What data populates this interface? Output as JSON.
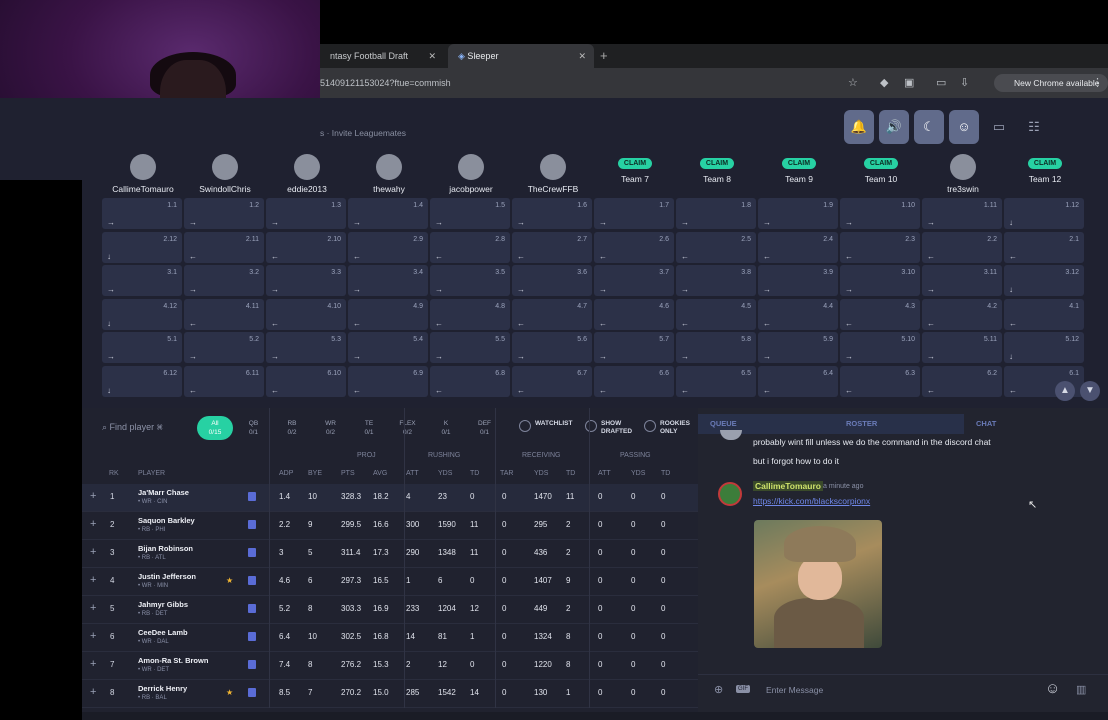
{
  "browser": {
    "tab1": "ntasy Football Draft Cheat",
    "tab2": "Sleeper",
    "url": "51409121153024?ftue=commish",
    "update": "New Chrome available"
  },
  "header": {
    "invite": "s · Invite Leaguemates"
  },
  "teams": [
    {
      "name": "CallimeTomauro",
      "online": true,
      "claim": false
    },
    {
      "name": "SwindollChris",
      "online": true,
      "claim": false
    },
    {
      "name": "eddie2013",
      "online": true,
      "claim": false
    },
    {
      "name": "thewahy",
      "online": false,
      "claim": false
    },
    {
      "name": "jacobpower",
      "online": true,
      "claim": false
    },
    {
      "name": "TheCrewFFB",
      "online": true,
      "claim": false
    },
    {
      "name": "Team 7",
      "online": false,
      "claim": true
    },
    {
      "name": "Team 8",
      "online": false,
      "claim": true
    },
    {
      "name": "Team 9",
      "online": false,
      "claim": true
    },
    {
      "name": "Team 10",
      "online": false,
      "claim": true
    },
    {
      "name": "tre3swin",
      "online": true,
      "claim": false
    },
    {
      "name": "Team 12",
      "online": false,
      "claim": true
    }
  ],
  "claim_label": "CLAIM",
  "rounds": 6,
  "filter": {
    "search": "Find player ⌘",
    "positions": [
      [
        "All",
        "0/15"
      ],
      [
        "QB",
        "0/1"
      ],
      [
        "RB",
        "0/2"
      ],
      [
        "WR",
        "0/2"
      ],
      [
        "TE",
        "0/1"
      ],
      [
        "FLEX",
        "0/2"
      ],
      [
        "K",
        "0/1"
      ],
      [
        "DEF",
        "0/1"
      ]
    ],
    "watchlist": "WATCHLIST",
    "show_drafted": "SHOW DRAFTED",
    "rookies": "ROOKIES ONLY"
  },
  "groups": [
    "PROJ",
    "RUSHING",
    "RECEIVING",
    "PASSING"
  ],
  "columns": [
    "RK",
    "PLAYER",
    "ADP",
    "BYE",
    "PTS",
    "AVG",
    "ATT",
    "YDS",
    "TD",
    "TAR",
    "YDS",
    "TD",
    "ATT",
    "YDS",
    "TD"
  ],
  "players": [
    {
      "rk": "1",
      "name": "Ja'Marr Chase",
      "pos": "• WR · CIN",
      "star": false,
      "v": [
        "1.4",
        "10",
        "328.3",
        "18.2",
        "4",
        "23",
        "0",
        "0",
        "1470",
        "11",
        "0",
        "0",
        "0"
      ]
    },
    {
      "rk": "2",
      "name": "Saquon Barkley",
      "pos": "• RB · PHI",
      "star": false,
      "v": [
        "2.2",
        "9",
        "299.5",
        "16.6",
        "300",
        "1590",
        "11",
        "0",
        "295",
        "2",
        "0",
        "0",
        "0"
      ]
    },
    {
      "rk": "3",
      "name": "Bijan Robinson",
      "pos": "• RB · ATL",
      "star": false,
      "v": [
        "3",
        "5",
        "311.4",
        "17.3",
        "290",
        "1348",
        "11",
        "0",
        "436",
        "2",
        "0",
        "0",
        "0"
      ]
    },
    {
      "rk": "4",
      "name": "Justin Jefferson",
      "pos": "• WR · MIN",
      "star": true,
      "v": [
        "4.6",
        "6",
        "297.3",
        "16.5",
        "1",
        "6",
        "0",
        "0",
        "1407",
        "9",
        "0",
        "0",
        "0"
      ]
    },
    {
      "rk": "5",
      "name": "Jahmyr Gibbs",
      "pos": "• RB · DET",
      "star": false,
      "v": [
        "5.2",
        "8",
        "303.3",
        "16.9",
        "233",
        "1204",
        "12",
        "0",
        "449",
        "2",
        "0",
        "0",
        "0"
      ]
    },
    {
      "rk": "6",
      "name": "CeeDee Lamb",
      "pos": "• WR · DAL",
      "star": false,
      "v": [
        "6.4",
        "10",
        "302.5",
        "16.8",
        "14",
        "81",
        "1",
        "0",
        "1324",
        "8",
        "0",
        "0",
        "0"
      ]
    },
    {
      "rk": "7",
      "name": "Amon-Ra St. Brown",
      "pos": "• WR · DET",
      "star": false,
      "v": [
        "7.4",
        "8",
        "276.2",
        "15.3",
        "2",
        "12",
        "0",
        "0",
        "1220",
        "8",
        "0",
        "0",
        "0"
      ]
    },
    {
      "rk": "8",
      "name": "Derrick Henry",
      "pos": "• RB · BAL",
      "star": true,
      "v": [
        "8.5",
        "7",
        "270.2",
        "15.0",
        "285",
        "1542",
        "14",
        "0",
        "130",
        "1",
        "0",
        "0",
        "0"
      ]
    }
  ],
  "chat": {
    "tabs": [
      "QUEUE",
      "ROSTER",
      "CHAT"
    ],
    "line1": "probably wint fill unless we do the command in the discord chat",
    "line2": "but i forgot how to do it",
    "author": "CallimeTomauro",
    "time": "a minute ago",
    "link": "https://kick.com/blackscorpionx",
    "placeholder": "Enter Message",
    "gif": "GIF"
  },
  "colors": {
    "accent": "#27d1a3",
    "bg": "#1f2130",
    "cell": "#2c3148"
  }
}
